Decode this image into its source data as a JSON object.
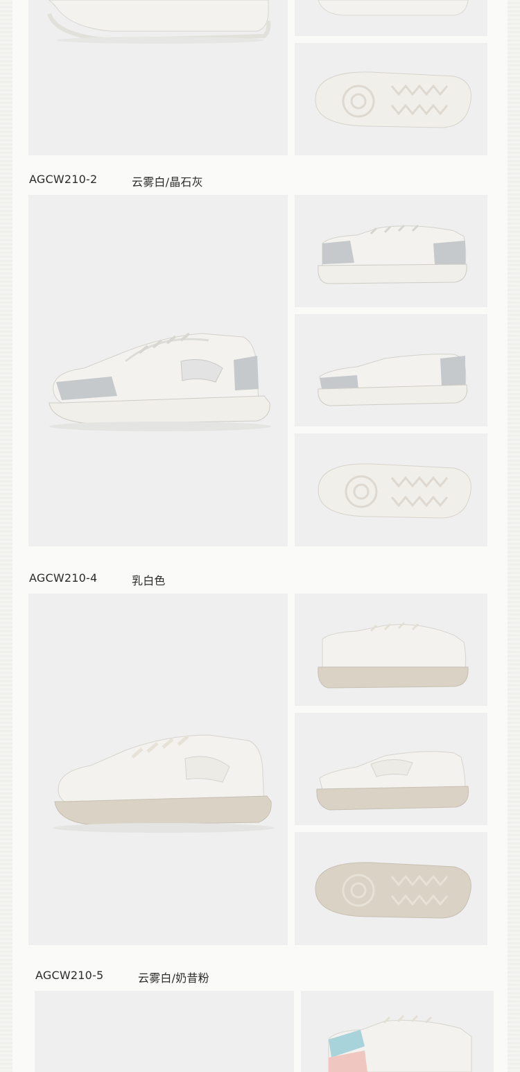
{
  "products": [
    {
      "code": "AGCW210-2",
      "color": "云雾白/晶石灰"
    },
    {
      "code": "AGCW210-4",
      "color": "乳白色"
    },
    {
      "code": "AGCW210-5",
      "color": "云雾白/奶昔粉"
    }
  ],
  "colors": {
    "tile_bg": "#efefef",
    "sole_white": "#f1efe9",
    "sole_beige": "#d9d2c5",
    "upper_white": "#f3f2ee",
    "grey_panel": "#c6c9cb",
    "blue_accent": "#a9d3da",
    "pink_accent": "#f0c6c1"
  }
}
